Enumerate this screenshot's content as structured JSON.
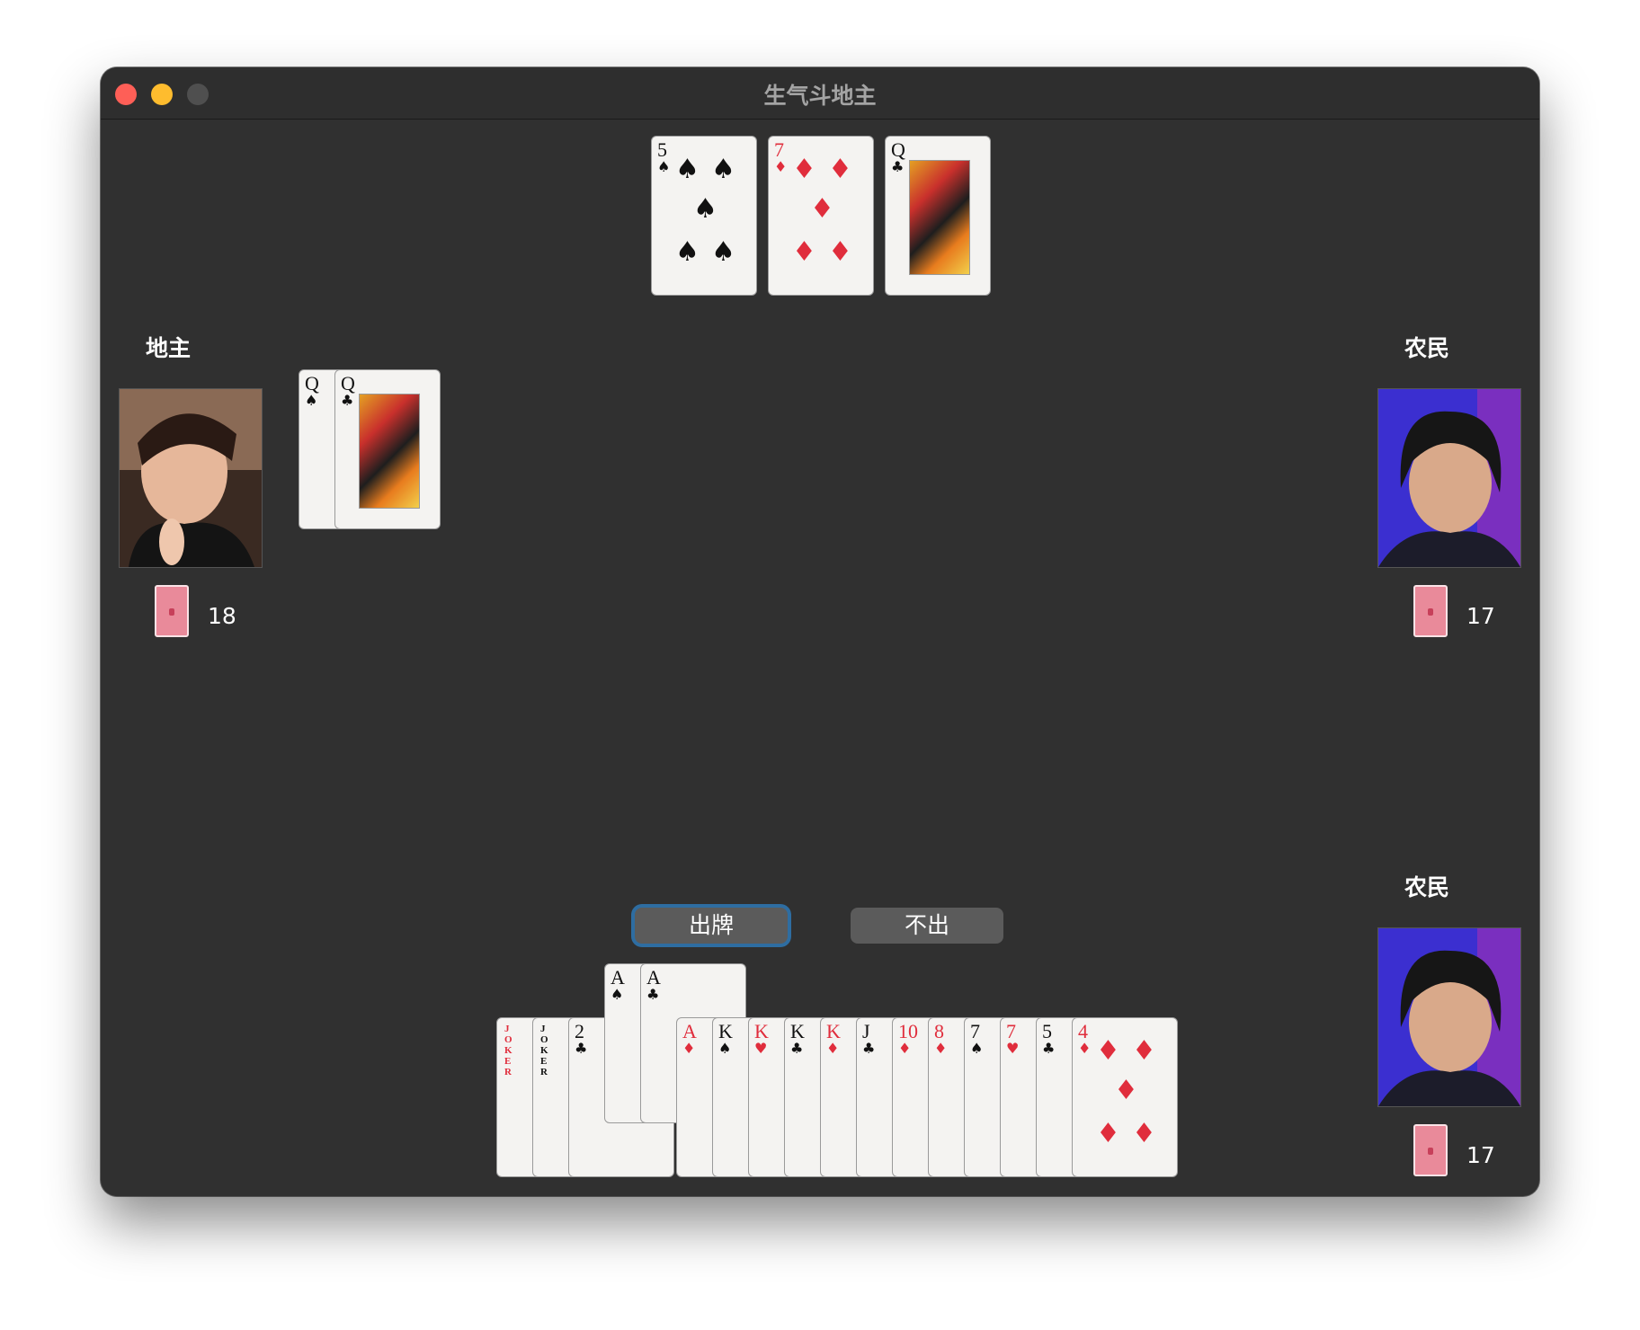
{
  "window": {
    "title": "生气斗地主"
  },
  "players": {
    "left": {
      "role": "地主",
      "cards_left": "18",
      "avatar": "landlord-avatar"
    },
    "right": {
      "role": "农民",
      "cards_left": "17",
      "avatar": "farmer-avatar"
    },
    "self": {
      "role": "农民",
      "cards_left": "17",
      "avatar": "farmer-avatar"
    }
  },
  "bottom_cards": [
    {
      "rank": "5",
      "suit": "♠",
      "color": "black"
    },
    {
      "rank": "7",
      "suit": "♦",
      "color": "red"
    },
    {
      "rank": "Q",
      "suit": "♣",
      "color": "black"
    }
  ],
  "played_cards_left": [
    {
      "rank": "Q",
      "suit": "♠",
      "color": "black"
    },
    {
      "rank": "Q",
      "suit": "♣",
      "color": "black"
    }
  ],
  "actions": {
    "play_label": "出牌",
    "pass_label": "不出"
  },
  "hand": [
    {
      "rank": "JOKER",
      "suit": "",
      "color": "red",
      "selected": false
    },
    {
      "rank": "JOKER",
      "suit": "",
      "color": "black",
      "selected": false
    },
    {
      "rank": "2",
      "suit": "♣",
      "color": "black",
      "selected": false
    },
    {
      "rank": "A",
      "suit": "♠",
      "color": "black",
      "selected": true
    },
    {
      "rank": "A",
      "suit": "♣",
      "color": "black",
      "selected": true
    },
    {
      "rank": "A",
      "suit": "♦",
      "color": "red",
      "selected": false
    },
    {
      "rank": "K",
      "suit": "♠",
      "color": "black",
      "selected": false
    },
    {
      "rank": "K",
      "suit": "♥",
      "color": "red",
      "selected": false
    },
    {
      "rank": "K",
      "suit": "♣",
      "color": "black",
      "selected": false
    },
    {
      "rank": "K",
      "suit": "♦",
      "color": "red",
      "selected": false
    },
    {
      "rank": "J",
      "suit": "♣",
      "color": "black",
      "selected": false
    },
    {
      "rank": "10",
      "suit": "♦",
      "color": "red",
      "selected": false
    },
    {
      "rank": "8",
      "suit": "♦",
      "color": "red",
      "selected": false
    },
    {
      "rank": "7",
      "suit": "♠",
      "color": "black",
      "selected": false
    },
    {
      "rank": "7",
      "suit": "♥",
      "color": "red",
      "selected": false
    },
    {
      "rank": "5",
      "suit": "♣",
      "color": "black",
      "selected": false
    },
    {
      "rank": "4",
      "suit": "♦",
      "color": "red",
      "selected": false
    }
  ]
}
